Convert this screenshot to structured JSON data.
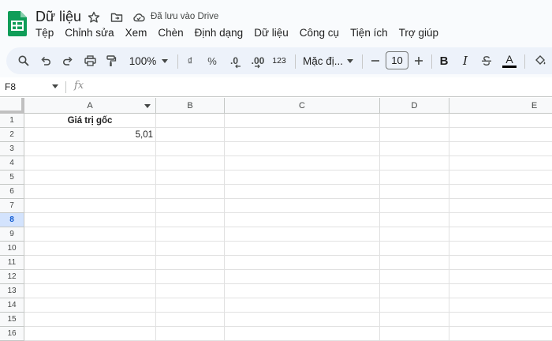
{
  "app": {
    "title": "Dữ liệu",
    "save_status": "Đã lưu vào Drive",
    "brand_color": "#0f9d58"
  },
  "menu": [
    "Tệp",
    "Chỉnh sửa",
    "Xem",
    "Chèn",
    "Định dạng",
    "Dữ liệu",
    "Công cụ",
    "Tiện ích",
    "Trợ giúp"
  ],
  "toolbar": {
    "zoom": "100%",
    "currency": "₫",
    "percent": "%",
    "dec_decrease": ".0",
    "dec_increase": ".00",
    "number_format": "123",
    "font": "Mặc đị...",
    "font_size": "10",
    "bold": "B",
    "italic": "I",
    "text_color": "A"
  },
  "formula_bar": {
    "cell_ref": "F8",
    "fx": "fx",
    "content": ""
  },
  "sheet": {
    "columns": [
      "A",
      "B",
      "C",
      "D",
      "E"
    ],
    "rows": [
      "1",
      "2",
      "3",
      "4",
      "5",
      "6",
      "7",
      "8",
      "9",
      "10",
      "11",
      "12",
      "13",
      "14",
      "15",
      "16"
    ],
    "active_row": "8",
    "cells": {
      "A1": "Giá trị gốc",
      "A2": "5,01"
    }
  }
}
